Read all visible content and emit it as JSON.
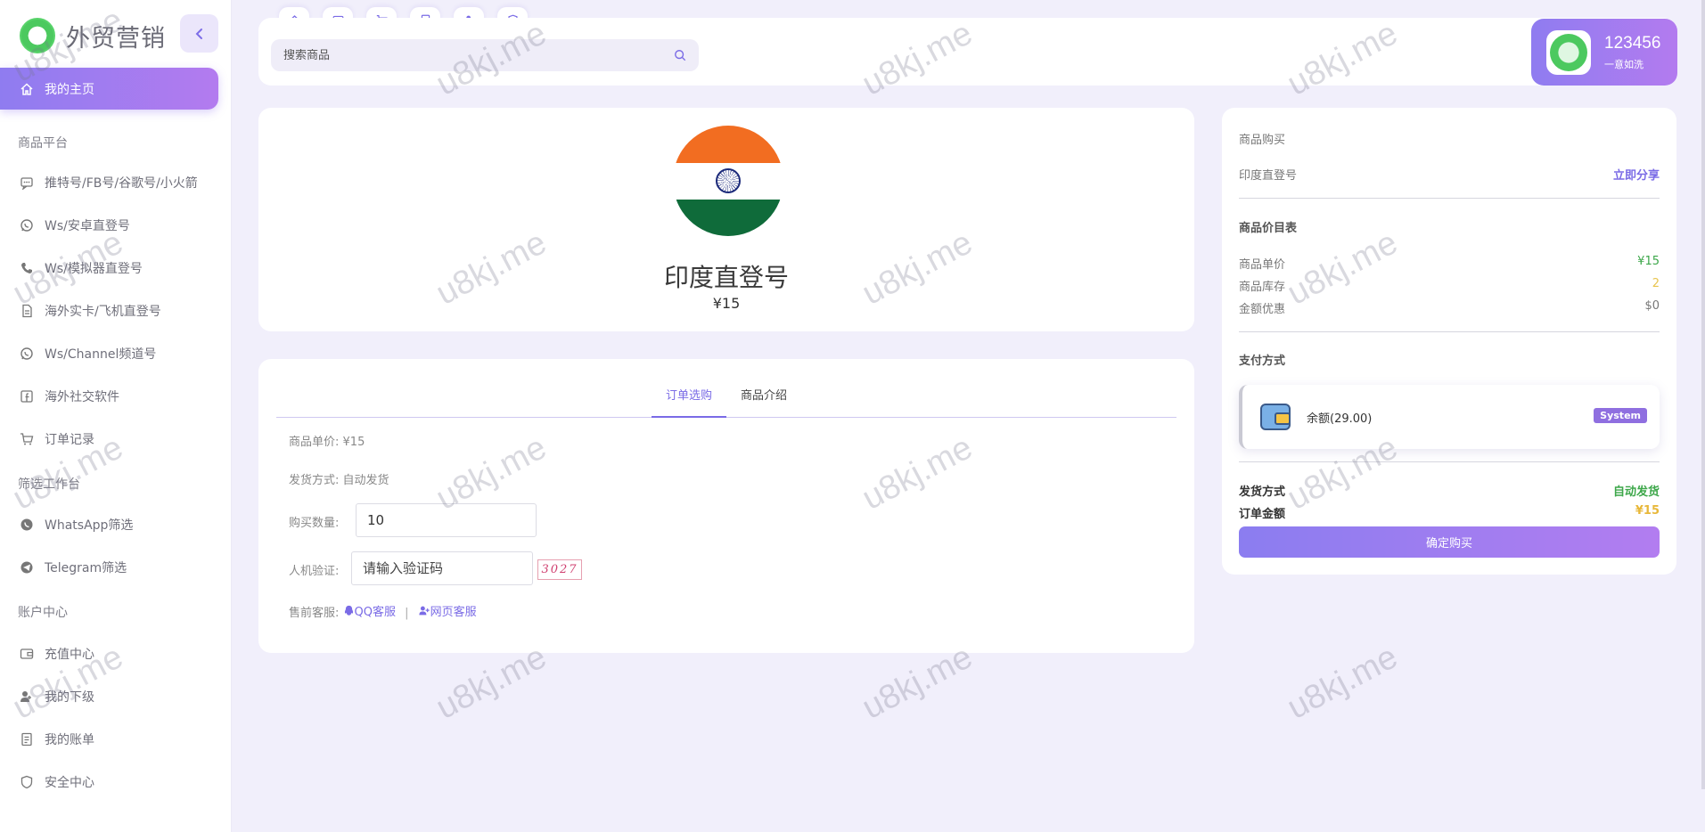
{
  "brand": {
    "name": "外贸营销"
  },
  "sidebar": {
    "home_label": "我的主页",
    "sections": [
      {
        "title": "商品平台",
        "items": [
          {
            "label": "推特号/FB号/谷歌号/小火箭",
            "icon": "chat-icon"
          },
          {
            "label": "Ws/安卓直登号",
            "icon": "whatsapp-icon"
          },
          {
            "label": "Ws/模拟器直登号",
            "icon": "phone-icon"
          },
          {
            "label": "海外实卡/飞机直登号",
            "icon": "document-icon"
          },
          {
            "label": "Ws/Channel频道号",
            "icon": "whatsapp-icon"
          },
          {
            "label": "海外社交软件",
            "icon": "facebook-icon"
          },
          {
            "label": "订单记录",
            "icon": "cart-icon"
          }
        ]
      },
      {
        "title": "筛选工作台",
        "items": [
          {
            "label": "WhatsApp筛选",
            "icon": "whatsapp-icon"
          },
          {
            "label": "Telegram筛选",
            "icon": "telegram-icon"
          }
        ]
      },
      {
        "title": "账户中心",
        "items": [
          {
            "label": "充值中心",
            "icon": "wallet-icon"
          },
          {
            "label": "我的下级",
            "icon": "users-icon"
          },
          {
            "label": "我的账单",
            "icon": "bill-icon"
          },
          {
            "label": "安全中心",
            "icon": "shield-icon"
          }
        ]
      }
    ]
  },
  "topbar": {
    "quick_icons": [
      "home-icon",
      "wallet-icon",
      "cart-icon",
      "document-icon",
      "user-icon",
      "shield-icon"
    ],
    "search_placeholder": "搜索商品",
    "user": {
      "name": "123456",
      "motto": "一意如洗"
    }
  },
  "product": {
    "title": "印度直登号",
    "price": "¥15"
  },
  "order": {
    "tabs": [
      "订单选购",
      "商品介绍"
    ],
    "active_tab": 0,
    "unit_price_label": "商品单价:",
    "unit_price_value": "¥15",
    "delivery_label": "发货方式:",
    "delivery_value": "自动发货",
    "quantity_label": "购买数量:",
    "quantity_value": "10",
    "captcha_label": "人机验证:",
    "captcha_placeholder": "请输入验证码",
    "captcha_code": "3027",
    "service_label": "售前客服:",
    "qq_service": "QQ客服",
    "separator": "|",
    "web_service": "网页客服"
  },
  "purchase": {
    "heading": "商品购买",
    "product_name": "印度直登号",
    "share_label": "立即分享",
    "price_list_title": "商品价目表",
    "price_rows": [
      {
        "label": "商品单价",
        "value": "¥15",
        "color": "#3da74a"
      },
      {
        "label": "商品库存",
        "value": "2",
        "color": "#e8c44e"
      },
      {
        "label": "金额优惠",
        "value": "$0",
        "color": "#777777"
      }
    ],
    "payment_title": "支付方式",
    "payment_option": "余额(29.00)",
    "payment_badge": "System",
    "delivery_label": "发货方式",
    "delivery_value": "自动发货",
    "total_label": "订单金额",
    "total_value": "¥15",
    "confirm_label": "确定购买"
  },
  "watermark": "u8kj.me",
  "colors": {
    "accent": "#8f7cf0",
    "accent2": "#b37bef",
    "green": "#3da74a",
    "gold": "#e8b83a"
  }
}
